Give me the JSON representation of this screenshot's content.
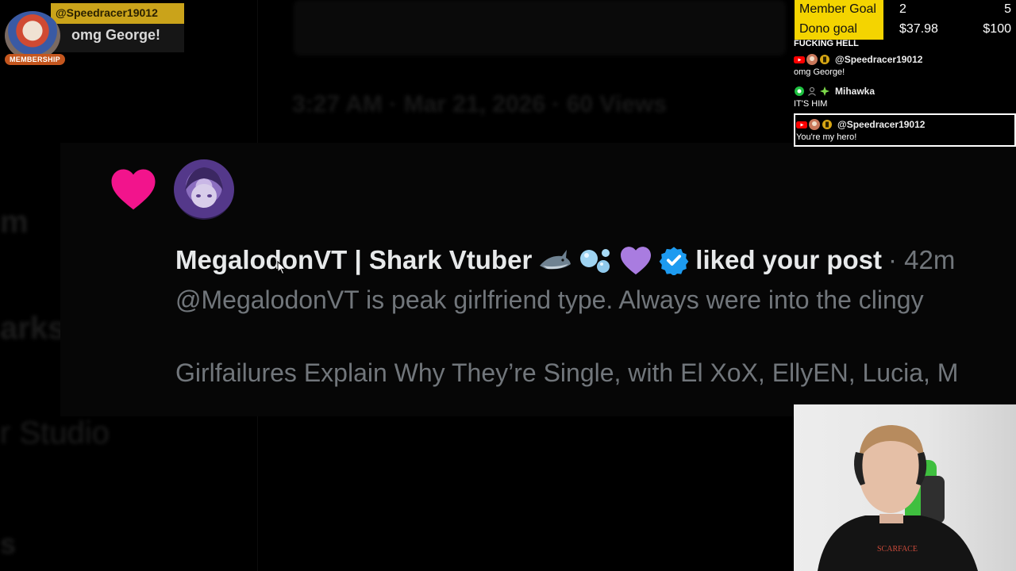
{
  "background": {
    "fragment_m": "m",
    "fragment_marks": "arks",
    "fragment_studio": "r Studio",
    "fragment_s": "s",
    "blurred_meta": "3:27 AM · Mar 21, 2026 · 60 Views"
  },
  "notification": {
    "name": "MegalodonVT | Shark Vtuber",
    "action": "liked your post",
    "time": "· 42m",
    "post_text": "@MegalodonVT is peak girlfriend type.  Always were into the clingy",
    "link_title": "Girlfailures Explain Why They’re Single, with El XoX, EllyEN, Lucia, M",
    "emojis": [
      "shark-emoji",
      "bubbles-emoji",
      "purple-heart-emoji",
      "verified-badge-icon"
    ],
    "heart_color": "#f2148c",
    "verified_color": "#1d9bf0"
  },
  "alert": {
    "username": "@Speedracer19012",
    "badge": "MEMBERSHIP",
    "message": "omg George!",
    "bar_color": "#caa31a"
  },
  "goals": {
    "member": {
      "label": "Member Goal",
      "current": "2",
      "target": "5"
    },
    "dono": {
      "label": "Dono goal",
      "current": "$37.98",
      "target": "$100"
    },
    "label_bg": "#f4d400"
  },
  "chat": {
    "fragment": "FUCKING HELL",
    "messages": [
      {
        "user": "@Speedracer19012",
        "text": "omg George!",
        "platform": "youtube-icon"
      },
      {
        "user": "Mihawka",
        "text": "IT'S HIM",
        "platform": "twitch-icon"
      },
      {
        "user": "@Speedracer19012",
        "text": "You're my hero!",
        "platform": "youtube-icon"
      }
    ]
  }
}
